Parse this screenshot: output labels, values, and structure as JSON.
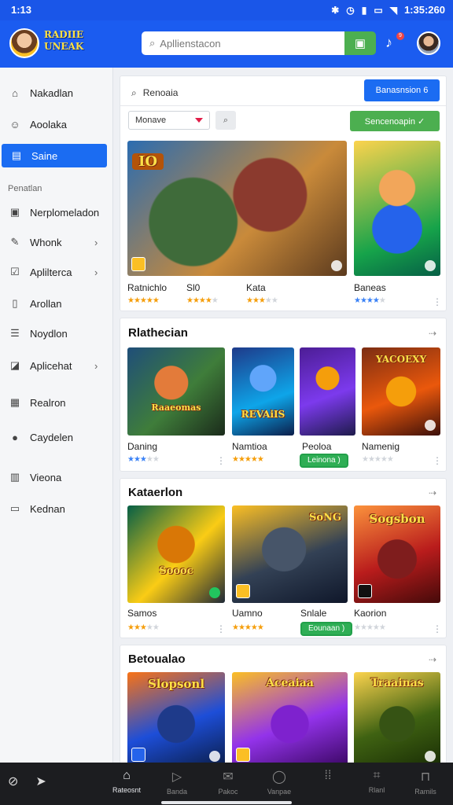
{
  "status": {
    "time": "1:13",
    "right_text": "1:35:260",
    "icons": [
      "bluetooth-icon",
      "alarm-icon",
      "signal-icon",
      "battery-icon",
      "wifi-icon"
    ]
  },
  "appbar": {
    "logo_text": "RADIIE UNEAK",
    "search_placeholder": "Apllienstacon",
    "notification_count": "9"
  },
  "sidebar": {
    "items_top": [
      {
        "label": "Nakadlan",
        "icon": "home-icon"
      },
      {
        "label": "Aoolaka",
        "icon": "users-icon"
      },
      {
        "label": "Saine",
        "icon": "grid-icon",
        "active": true
      }
    ],
    "section_label": "Penatlan",
    "items_bottom": [
      {
        "label": "Nerplomeladon",
        "icon": "window-icon",
        "chevron": false
      },
      {
        "label": "Whonk",
        "icon": "edit-icon",
        "chevron": true
      },
      {
        "label": "Aplilterca",
        "icon": "check-icon",
        "chevron": true
      },
      {
        "label": "Arollan",
        "icon": "doc-icon",
        "chevron": false
      },
      {
        "label": "Noydlon",
        "icon": "list-icon",
        "chevron": false
      },
      {
        "label": "Aplicehat",
        "icon": "chart-icon",
        "chevron": true
      },
      {
        "label": "Realron",
        "icon": "calendar-icon",
        "chevron": false
      },
      {
        "label": "Caydelen",
        "icon": "pin-icon",
        "chevron": false
      },
      {
        "label": "Vieona",
        "icon": "book-icon",
        "chevron": false
      },
      {
        "label": "Kednan",
        "icon": "folder-icon",
        "chevron": false
      }
    ]
  },
  "top_card": {
    "search_text": "Renoaia",
    "blue_button": "Banasnsion 6",
    "select_value": "Monave",
    "green_button": "Sencenoapin ✓",
    "featured": [
      {
        "title": "Ratnichlo",
        "subtitle": "Sl0",
        "rating": 4
      },
      {
        "title": "Kata",
        "subtitle": "",
        "rating": 3
      },
      {
        "title": "Baneas",
        "subtitle": "",
        "rating": 4
      }
    ],
    "thumb_words": [
      "IO",
      ""
    ]
  },
  "sections": [
    {
      "title": "Rlathecian",
      "action": "⇢",
      "games": [
        {
          "title": "Daning",
          "rating": 3,
          "thumb_word": "Raaeomas",
          "pill": ""
        },
        {
          "title": "Namtioa",
          "rating": 5,
          "thumb_word": "REVAiIS",
          "pill": ""
        },
        {
          "title": "Peoloa",
          "rating": 0,
          "thumb_word": "",
          "pill": "Leinona )"
        },
        {
          "title": "Namenig",
          "rating": 0,
          "thumb_word": "YACOEXY",
          "pill": ""
        }
      ]
    },
    {
      "title": "Kataerlon",
      "action": "⇢",
      "games": [
        {
          "title": "Samos",
          "rating": 3,
          "thumb_word": "Soooc",
          "pill": ""
        },
        {
          "title": "Uamno",
          "rating": 5,
          "thumb_word": "SoNG",
          "pill": ""
        },
        {
          "title": "Snlale",
          "rating": 0,
          "thumb_word": "",
          "pill": "Eounaan )"
        },
        {
          "title": "Kaorion",
          "rating": 0,
          "thumb_word": "Sogsbon",
          "pill": ""
        }
      ]
    },
    {
      "title": "Betoualao",
      "action": "⇢",
      "games": [
        {
          "title": "",
          "rating": 0,
          "thumb_word": "Slopsonl",
          "pill": ""
        },
        {
          "title": "",
          "rating": 0,
          "thumb_word": "Aceaiaa",
          "pill": ""
        },
        {
          "title": "",
          "rating": 0,
          "thumb_word": "Traainas",
          "pill": ""
        }
      ]
    }
  ],
  "bottom_nav": [
    {
      "label": "Rateosnt",
      "icon": "home-icon",
      "active": true
    },
    {
      "label": "Banda",
      "icon": "play-icon",
      "active": false
    },
    {
      "label": "Pakoc",
      "icon": "mail-icon",
      "active": false
    },
    {
      "label": "Vanpae",
      "icon": "search-icon",
      "active": false
    },
    {
      "label": "",
      "icon": "dots-icon",
      "active": false
    },
    {
      "label": "Rlanl",
      "icon": "scan-icon",
      "active": false
    },
    {
      "label": "Ramils",
      "icon": "bag-icon",
      "active": false
    }
  ],
  "colors": {
    "primary": "#1b5cf0",
    "accent_green": "#4caf50",
    "star": "#f59e0b"
  }
}
